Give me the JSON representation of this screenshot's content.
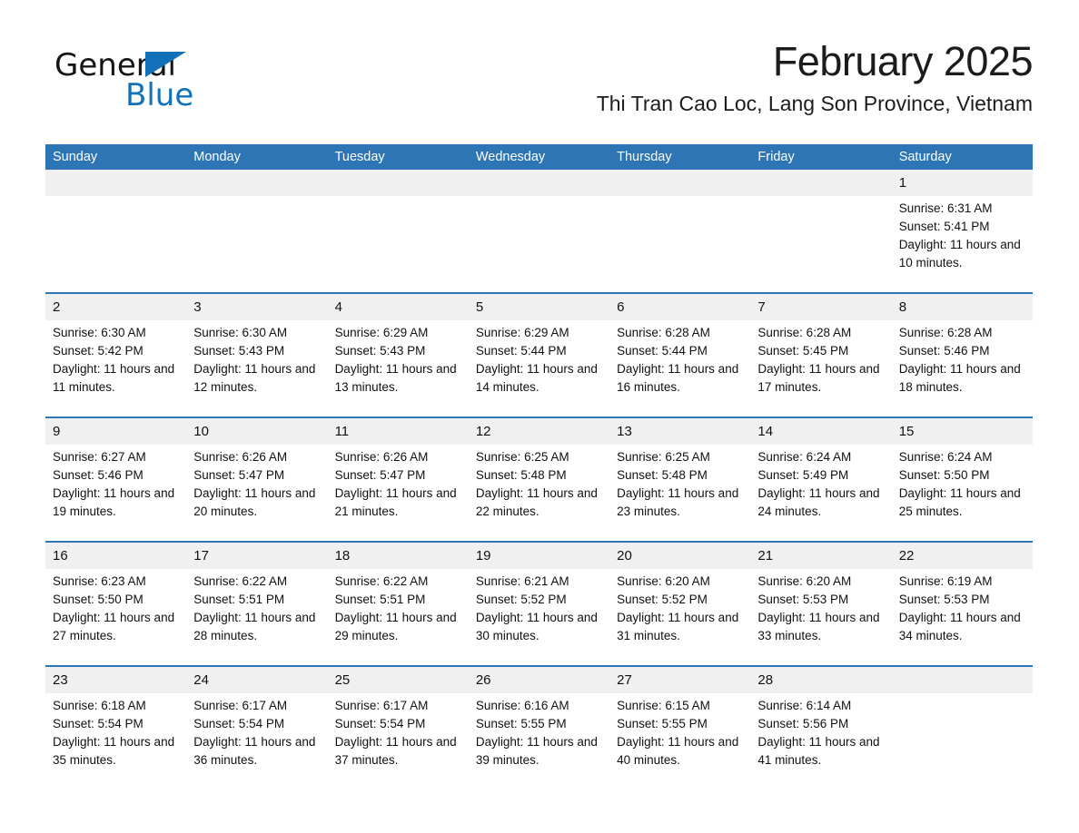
{
  "brand": {
    "logo_text_1": "General",
    "logo_text_2": "Blue",
    "accent_color": "#1271b9",
    "header_color": "#2e75b6",
    "band_color": "#f0f0f0"
  },
  "header": {
    "month_title": "February 2025",
    "location": "Thi Tran Cao Loc, Lang Son Province, Vietnam"
  },
  "weekdays": [
    {
      "label": "Sunday"
    },
    {
      "label": "Monday"
    },
    {
      "label": "Tuesday"
    },
    {
      "label": "Wednesday"
    },
    {
      "label": "Thursday"
    },
    {
      "label": "Friday"
    },
    {
      "label": "Saturday"
    }
  ],
  "weeks": [
    [
      {
        "day": "",
        "sunrise": "",
        "sunset": "",
        "daylight": "",
        "empty": true
      },
      {
        "day": "",
        "sunrise": "",
        "sunset": "",
        "daylight": "",
        "empty": true
      },
      {
        "day": "",
        "sunrise": "",
        "sunset": "",
        "daylight": "",
        "empty": true
      },
      {
        "day": "",
        "sunrise": "",
        "sunset": "",
        "daylight": "",
        "empty": true
      },
      {
        "day": "",
        "sunrise": "",
        "sunset": "",
        "daylight": "",
        "empty": true
      },
      {
        "day": "",
        "sunrise": "",
        "sunset": "",
        "daylight": "",
        "empty": true
      },
      {
        "day": "1",
        "sunrise": "Sunrise: 6:31 AM",
        "sunset": "Sunset: 5:41 PM",
        "daylight": "Daylight: 11 hours and 10 minutes.",
        "empty": false
      }
    ],
    [
      {
        "day": "2",
        "sunrise": "Sunrise: 6:30 AM",
        "sunset": "Sunset: 5:42 PM",
        "daylight": "Daylight: 11 hours and 11 minutes.",
        "empty": false
      },
      {
        "day": "3",
        "sunrise": "Sunrise: 6:30 AM",
        "sunset": "Sunset: 5:43 PM",
        "daylight": "Daylight: 11 hours and 12 minutes.",
        "empty": false
      },
      {
        "day": "4",
        "sunrise": "Sunrise: 6:29 AM",
        "sunset": "Sunset: 5:43 PM",
        "daylight": "Daylight: 11 hours and 13 minutes.",
        "empty": false
      },
      {
        "day": "5",
        "sunrise": "Sunrise: 6:29 AM",
        "sunset": "Sunset: 5:44 PM",
        "daylight": "Daylight: 11 hours and 14 minutes.",
        "empty": false
      },
      {
        "day": "6",
        "sunrise": "Sunrise: 6:28 AM",
        "sunset": "Sunset: 5:44 PM",
        "daylight": "Daylight: 11 hours and 16 minutes.",
        "empty": false
      },
      {
        "day": "7",
        "sunrise": "Sunrise: 6:28 AM",
        "sunset": "Sunset: 5:45 PM",
        "daylight": "Daylight: 11 hours and 17 minutes.",
        "empty": false
      },
      {
        "day": "8",
        "sunrise": "Sunrise: 6:28 AM",
        "sunset": "Sunset: 5:46 PM",
        "daylight": "Daylight: 11 hours and 18 minutes.",
        "empty": false
      }
    ],
    [
      {
        "day": "9",
        "sunrise": "Sunrise: 6:27 AM",
        "sunset": "Sunset: 5:46 PM",
        "daylight": "Daylight: 11 hours and 19 minutes.",
        "empty": false
      },
      {
        "day": "10",
        "sunrise": "Sunrise: 6:26 AM",
        "sunset": "Sunset: 5:47 PM",
        "daylight": "Daylight: 11 hours and 20 minutes.",
        "empty": false
      },
      {
        "day": "11",
        "sunrise": "Sunrise: 6:26 AM",
        "sunset": "Sunset: 5:47 PM",
        "daylight": "Daylight: 11 hours and 21 minutes.",
        "empty": false
      },
      {
        "day": "12",
        "sunrise": "Sunrise: 6:25 AM",
        "sunset": "Sunset: 5:48 PM",
        "daylight": "Daylight: 11 hours and 22 minutes.",
        "empty": false
      },
      {
        "day": "13",
        "sunrise": "Sunrise: 6:25 AM",
        "sunset": "Sunset: 5:48 PM",
        "daylight": "Daylight: 11 hours and 23 minutes.",
        "empty": false
      },
      {
        "day": "14",
        "sunrise": "Sunrise: 6:24 AM",
        "sunset": "Sunset: 5:49 PM",
        "daylight": "Daylight: 11 hours and 24 minutes.",
        "empty": false
      },
      {
        "day": "15",
        "sunrise": "Sunrise: 6:24 AM",
        "sunset": "Sunset: 5:50 PM",
        "daylight": "Daylight: 11 hours and 25 minutes.",
        "empty": false
      }
    ],
    [
      {
        "day": "16",
        "sunrise": "Sunrise: 6:23 AM",
        "sunset": "Sunset: 5:50 PM",
        "daylight": "Daylight: 11 hours and 27 minutes.",
        "empty": false
      },
      {
        "day": "17",
        "sunrise": "Sunrise: 6:22 AM",
        "sunset": "Sunset: 5:51 PM",
        "daylight": "Daylight: 11 hours and 28 minutes.",
        "empty": false
      },
      {
        "day": "18",
        "sunrise": "Sunrise: 6:22 AM",
        "sunset": "Sunset: 5:51 PM",
        "daylight": "Daylight: 11 hours and 29 minutes.",
        "empty": false
      },
      {
        "day": "19",
        "sunrise": "Sunrise: 6:21 AM",
        "sunset": "Sunset: 5:52 PM",
        "daylight": "Daylight: 11 hours and 30 minutes.",
        "empty": false
      },
      {
        "day": "20",
        "sunrise": "Sunrise: 6:20 AM",
        "sunset": "Sunset: 5:52 PM",
        "daylight": "Daylight: 11 hours and 31 minutes.",
        "empty": false
      },
      {
        "day": "21",
        "sunrise": "Sunrise: 6:20 AM",
        "sunset": "Sunset: 5:53 PM",
        "daylight": "Daylight: 11 hours and 33 minutes.",
        "empty": false
      },
      {
        "day": "22",
        "sunrise": "Sunrise: 6:19 AM",
        "sunset": "Sunset: 5:53 PM",
        "daylight": "Daylight: 11 hours and 34 minutes.",
        "empty": false
      }
    ],
    [
      {
        "day": "23",
        "sunrise": "Sunrise: 6:18 AM",
        "sunset": "Sunset: 5:54 PM",
        "daylight": "Daylight: 11 hours and 35 minutes.",
        "empty": false
      },
      {
        "day": "24",
        "sunrise": "Sunrise: 6:17 AM",
        "sunset": "Sunset: 5:54 PM",
        "daylight": "Daylight: 11 hours and 36 minutes.",
        "empty": false
      },
      {
        "day": "25",
        "sunrise": "Sunrise: 6:17 AM",
        "sunset": "Sunset: 5:54 PM",
        "daylight": "Daylight: 11 hours and 37 minutes.",
        "empty": false
      },
      {
        "day": "26",
        "sunrise": "Sunrise: 6:16 AM",
        "sunset": "Sunset: 5:55 PM",
        "daylight": "Daylight: 11 hours and 39 minutes.",
        "empty": false
      },
      {
        "day": "27",
        "sunrise": "Sunrise: 6:15 AM",
        "sunset": "Sunset: 5:55 PM",
        "daylight": "Daylight: 11 hours and 40 minutes.",
        "empty": false
      },
      {
        "day": "28",
        "sunrise": "Sunrise: 6:14 AM",
        "sunset": "Sunset: 5:56 PM",
        "daylight": "Daylight: 11 hours and 41 minutes.",
        "empty": false
      },
      {
        "day": "",
        "sunrise": "",
        "sunset": "",
        "daylight": "",
        "empty": true
      }
    ]
  ]
}
